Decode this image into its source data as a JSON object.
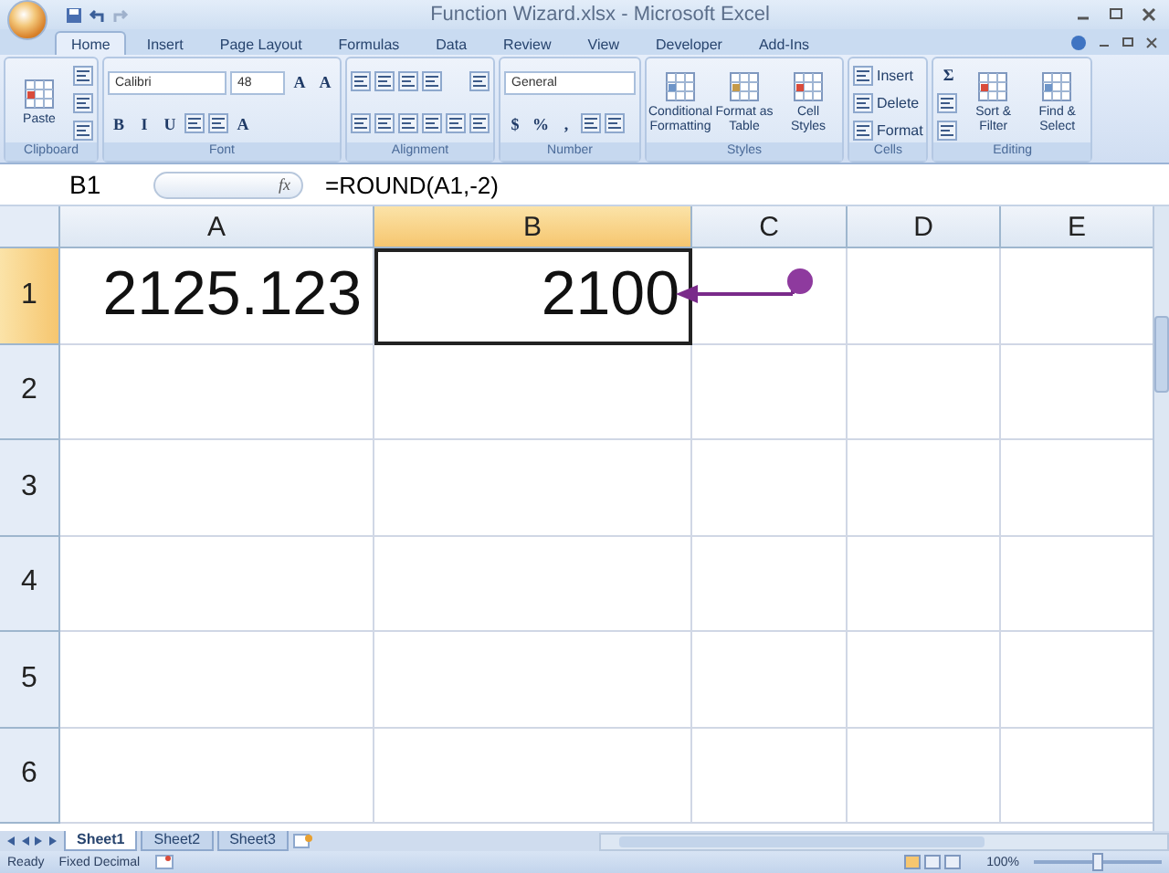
{
  "window": {
    "title": "Function Wizard.xlsx - Microsoft Excel"
  },
  "tabs": [
    {
      "label": "Home",
      "selected": true
    },
    {
      "label": "Insert",
      "selected": false
    },
    {
      "label": "Page Layout",
      "selected": false
    },
    {
      "label": "Formulas",
      "selected": false
    },
    {
      "label": "Data",
      "selected": false
    },
    {
      "label": "Review",
      "selected": false
    },
    {
      "label": "View",
      "selected": false
    },
    {
      "label": "Developer",
      "selected": false
    },
    {
      "label": "Add-Ins",
      "selected": false
    }
  ],
  "ribbon": [
    {
      "label": "Clipboard",
      "columns": [
        [
          [
            {
              "kind": "large",
              "label": "Paste"
            }
          ]
        ],
        [
          [
            {
              "kind": "icon"
            }
          ],
          [
            {
              "kind": "icon"
            }
          ],
          [
            {
              "kind": "icon"
            }
          ]
        ]
      ]
    },
    {
      "label": "Font",
      "columns": [
        [
          [
            {
              "kind": "field",
              "value": "Calibri"
            },
            {
              "kind": "field",
              "value": "48"
            },
            {
              "kind": "glyph",
              "text": "A"
            },
            {
              "kind": "glyph",
              "text": "A"
            }
          ],
          [
            {
              "kind": "glyph",
              "text": "B"
            },
            {
              "kind": "glyph",
              "text": "I"
            },
            {
              "kind": "glyph",
              "text": "U"
            },
            {
              "kind": "icon"
            },
            {
              "kind": "icon"
            },
            {
              "kind": "glyph",
              "text": "A"
            }
          ]
        ]
      ]
    },
    {
      "label": "Alignment",
      "columns": [
        [
          [
            {
              "kind": "icon"
            },
            {
              "kind": "icon"
            },
            {
              "kind": "icon"
            },
            {
              "kind": "icon"
            }
          ],
          [
            {
              "kind": "icon"
            },
            {
              "kind": "icon"
            },
            {
              "kind": "icon"
            },
            {
              "kind": "icon"
            },
            {
              "kind": "icon"
            }
          ]
        ],
        [
          [
            {
              "kind": "icon"
            }
          ],
          [
            {
              "kind": "icon"
            }
          ]
        ]
      ]
    },
    {
      "label": "Number",
      "columns": [
        [
          [
            {
              "kind": "field",
              "value": "General"
            }
          ],
          [
            {
              "kind": "glyph",
              "text": "$"
            },
            {
              "kind": "glyph",
              "text": "%"
            },
            {
              "kind": "glyph",
              "text": ","
            },
            {
              "kind": "icon"
            },
            {
              "kind": "icon"
            }
          ]
        ]
      ]
    },
    {
      "label": "Styles",
      "columns": [
        [
          [
            {
              "kind": "large",
              "label": "Conditional Formatting"
            },
            {
              "kind": "large",
              "label": "Format as Table"
            },
            {
              "kind": "large",
              "label": "Cell Styles"
            }
          ]
        ]
      ]
    },
    {
      "label": "Cells",
      "columns": [
        [
          [
            {
              "kind": "small",
              "label": "Insert"
            }
          ],
          [
            {
              "kind": "small",
              "label": "Delete"
            }
          ],
          [
            {
              "kind": "small",
              "label": "Format"
            }
          ]
        ]
      ]
    },
    {
      "label": "Editing",
      "columns": [
        [
          [
            {
              "kind": "glyph",
              "text": "Σ"
            }
          ],
          [
            {
              "kind": "icon"
            }
          ],
          [
            {
              "kind": "icon"
            }
          ]
        ],
        [
          [
            {
              "kind": "large",
              "label": "Sort & Filter"
            },
            {
              "kind": "large",
              "label": "Find & Select"
            }
          ]
        ]
      ]
    }
  ],
  "formula_bar": {
    "name_box": "B1",
    "fx": "fx",
    "formula": "=ROUND(A1,-2)"
  },
  "columns": [
    {
      "label": "A",
      "selected": false
    },
    {
      "label": "B",
      "selected": true
    },
    {
      "label": "C",
      "selected": false
    },
    {
      "label": "D",
      "selected": false
    },
    {
      "label": "E",
      "selected": false
    }
  ],
  "rows": [
    {
      "header": "1",
      "selected": true,
      "cells": [
        {
          "value": "2125.123",
          "selected": false
        },
        {
          "value": "2100",
          "selected": true
        }
      ]
    },
    {
      "header": "2",
      "selected": false
    },
    {
      "header": "3",
      "selected": false
    },
    {
      "header": "4",
      "selected": false
    },
    {
      "header": "5",
      "selected": false
    },
    {
      "header": "6",
      "selected": false
    }
  ],
  "sheets": [
    {
      "label": "Sheet1",
      "selected": true
    },
    {
      "label": "Sheet2",
      "selected": false
    },
    {
      "label": "Sheet3",
      "selected": false
    }
  ],
  "status": {
    "items": [
      "Ready",
      "Fixed Decimal"
    ],
    "zoom": "100%",
    "zoom_slider": {
      "level": 0.5
    }
  }
}
